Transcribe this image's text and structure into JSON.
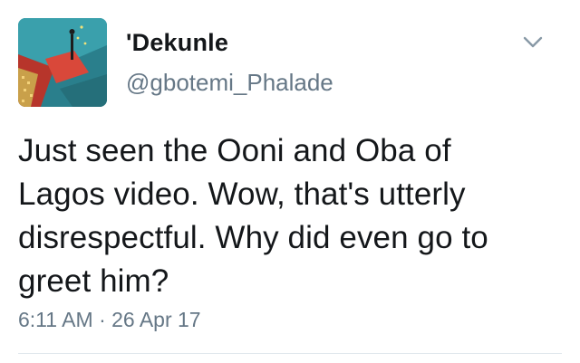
{
  "author": {
    "display_name": "'Dekunle",
    "handle": "@gbotemi_Phalade",
    "avatar_icon": "profile-photo-avatar"
  },
  "tweet": {
    "lines": [
      "Just seen the Ooni and Oba of",
      "Lagos video. Wow, that's utterly",
      "disrespectful. Why did even go to",
      "greet him?"
    ],
    "timestamp": "6:11 AM · 26 Apr 17"
  },
  "menu": {
    "icon": "chevron-down-icon"
  },
  "colors": {
    "primary_text": "#14171a",
    "secondary_text": "#657786",
    "divider": "#e1e8ed",
    "background": "#ffffff"
  }
}
